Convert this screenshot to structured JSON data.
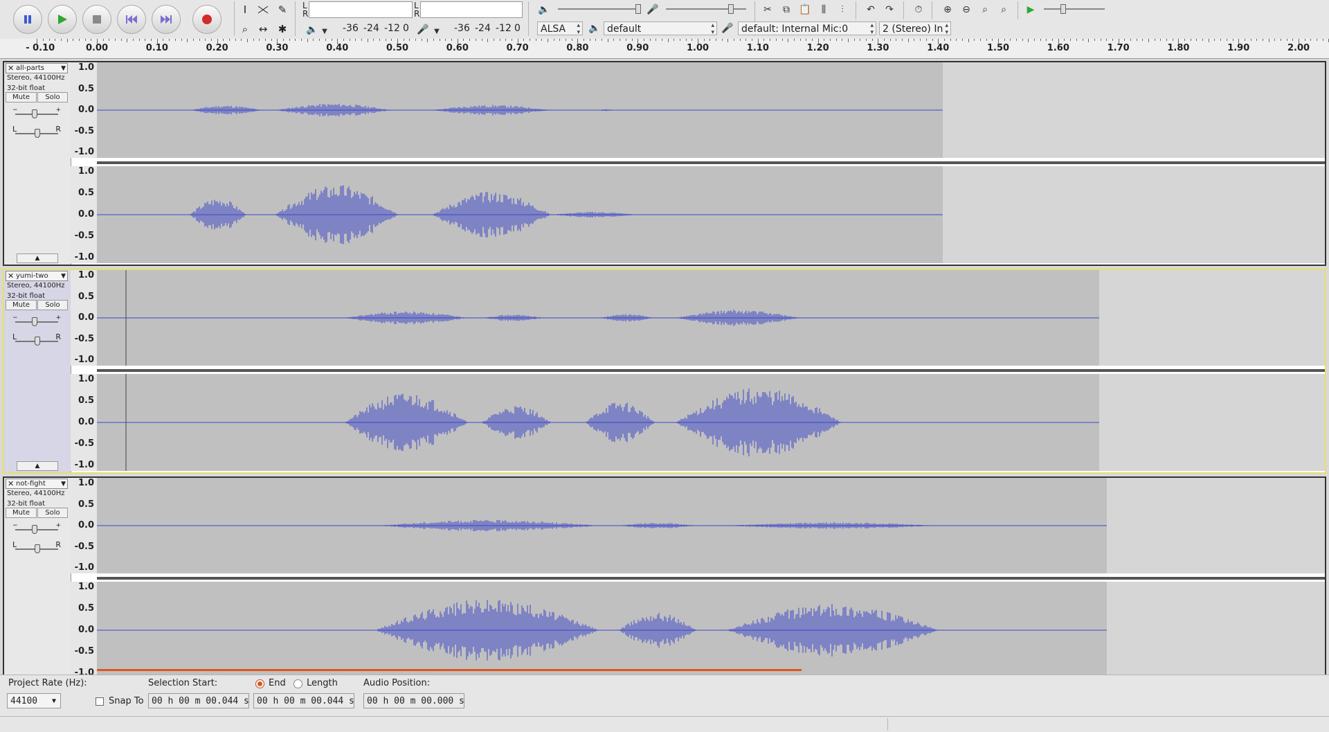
{
  "transport": {
    "pause": "pause-button",
    "play": "play-button",
    "stop": "stop-button",
    "skip_start": "skip-to-start-button",
    "skip_end": "skip-to-end-button",
    "record": "record-button"
  },
  "meters": {
    "play_l": "L",
    "play_r": "R",
    "rec_l": "L",
    "rec_r": "R",
    "play_scale": [
      "-36",
      "-24",
      "-12",
      "0"
    ],
    "rec_scale": [
      "-36",
      "-24",
      "-12",
      "0"
    ]
  },
  "device": {
    "host": "ALSA",
    "output": "default",
    "input": "default: Internal Mic:0",
    "channels": "2 (Stereo) In"
  },
  "ruler": {
    "labels": [
      "- 0.10",
      "0.00",
      "0.10",
      "0.20",
      "0.30",
      "0.40",
      "0.50",
      "0.60",
      "0.70",
      "0.80",
      "0.90",
      "1.00",
      "1.10",
      "1.20",
      "1.30",
      "1.40",
      "1.50",
      "1.60",
      "1.70",
      "1.80",
      "1.90",
      "2.00"
    ]
  },
  "scale_labels": [
    "1.0",
    "0.5",
    "0.0",
    "-0.5",
    "-1.0"
  ],
  "tracks": [
    {
      "name": "all-parts",
      "info1": "Stereo, 44100Hz",
      "info2": "32-bit float",
      "mute": "Mute",
      "solo": "Solo",
      "l": "L",
      "r": "R",
      "selected": false
    },
    {
      "name": "yumi-two",
      "info1": "Stereo, 44100Hz",
      "info2": "32-bit float",
      "mute": "Mute",
      "solo": "Solo",
      "l": "L",
      "r": "R",
      "selected": true
    },
    {
      "name": "not-fight",
      "info1": "Stereo, 44100Hz",
      "info2": "32-bit float",
      "mute": "Mute",
      "solo": "Solo",
      "l": "L",
      "r": "R",
      "selected": false
    }
  ],
  "bottom": {
    "project_rate_label": "Project Rate (Hz):",
    "project_rate": "44100",
    "snap_to": "Snap To",
    "selection_start_label": "Selection Start:",
    "end_label": "End",
    "length_label": "Length",
    "audio_position_label": "Audio Position:",
    "selection_start": "00 h 00 m 00.044 s",
    "selection_end": "00 h 00 m 00.044 s",
    "audio_position": "00 h 00 m 00.000 s"
  },
  "colors": {
    "waveform": "#3b46c8",
    "clip": "#c0c0c0",
    "selected_border": "#e6e06a"
  }
}
